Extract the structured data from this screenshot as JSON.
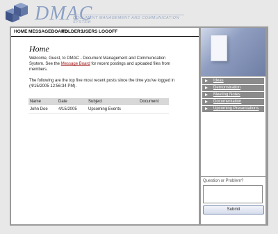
{
  "brand": {
    "name": "DMAC",
    "tagline": "DOCUMENT MANAGEMENT AND COMMUNICATION SYSTEM"
  },
  "nav": {
    "home": "HOME",
    "messageboard": "MESSAGEBOARD",
    "folders": "FOLDERS",
    "users": "USERS",
    "logoff": "LOGOFF"
  },
  "main": {
    "title": "Home",
    "welcome_before_link": "Welcome, Guest, to DMAC - Document Management and Communication System. See the ",
    "welcome_link": "Message Board",
    "welcome_after_link": " for recent postings and uploaded files from members.",
    "recent_intro": "The following are the top five most recent posts since the time you've logged in (4/15/2005 12:56:34 PM).",
    "table": {
      "headers": [
        "Name",
        "Date",
        "Subject",
        "Document"
      ],
      "rows": [
        {
          "name": "John Doe",
          "date": "4/15/2005",
          "subject": "Upcoming Events",
          "document": ""
        }
      ]
    }
  },
  "sidebar": {
    "links": [
      "Ideas",
      "Demonstration",
      "Meeting Notes",
      "Documentation",
      "Upcoming Presentations"
    ],
    "question_label": "Question or Problem?",
    "question_value": "",
    "submit_label": "Submit"
  }
}
